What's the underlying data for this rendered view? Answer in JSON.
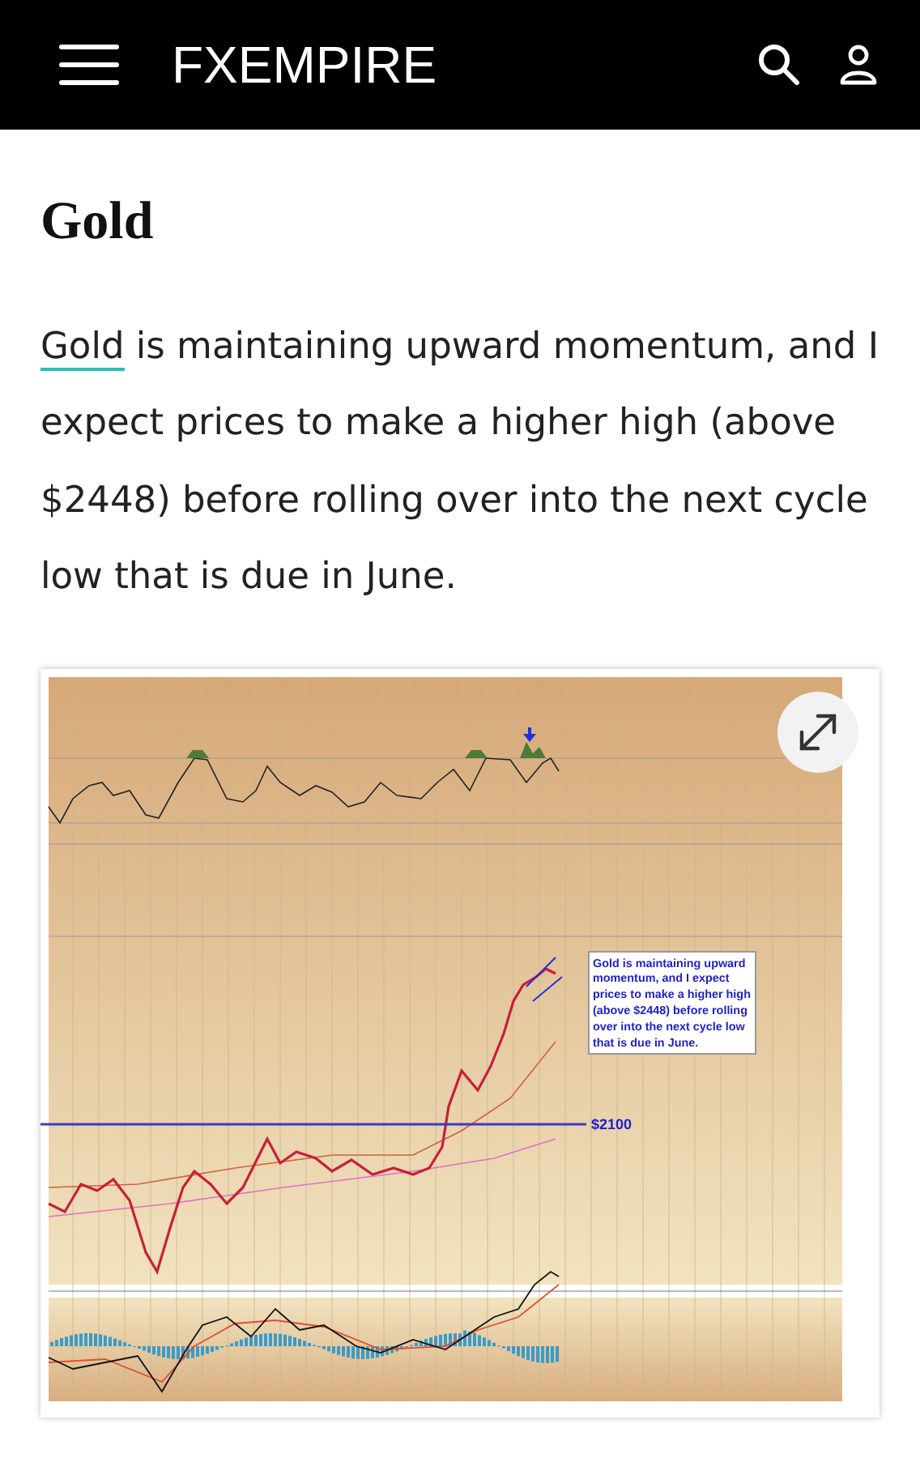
{
  "header": {
    "logo": "FXEMPIRE"
  },
  "article": {
    "title": "Gold",
    "intro_link": "Gold",
    "intro_rest": " is maintaining upward momentum, and I expect prices to make a higher high (above $2448) before rolling over into the next cycle low that is due in June."
  },
  "chart": {
    "level_label": "$2100",
    "callout": "Gold is maintaining upward momentum, and I expect prices to make a higher high (above $2448) before rolling over into the next cycle low that is due in June."
  }
}
